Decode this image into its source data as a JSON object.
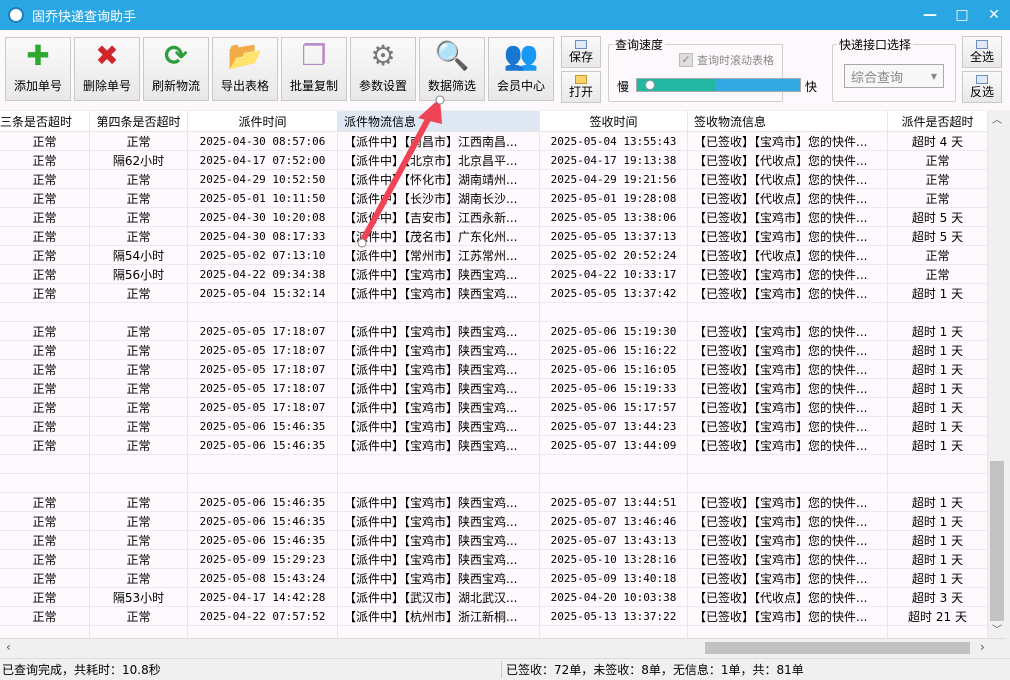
{
  "window": {
    "title": "固乔快递查询助手",
    "minimize": "—",
    "maximize": "□",
    "close": "✕",
    "accent": "#2aa7e3"
  },
  "toolbar": {
    "buttons": [
      {
        "label": "添加单号",
        "icon": "plus-icon"
      },
      {
        "label": "删除单号",
        "icon": "delete-x-icon"
      },
      {
        "label": "刷新物流",
        "icon": "refresh-icon"
      },
      {
        "label": "导出表格",
        "icon": "folder-export-icon"
      },
      {
        "label": "批量复制",
        "icon": "copy-icon"
      },
      {
        "label": "参数设置",
        "icon": "gear-icon"
      },
      {
        "label": "数据筛选",
        "icon": "search-filter-icon"
      },
      {
        "label": "会员中心",
        "icon": "members-icon"
      }
    ],
    "save": "保存",
    "open": "打开",
    "speed": {
      "title": "查询速度",
      "scroll_checkbox": "查询时滚动表格",
      "scroll_checked": true,
      "slow": "慢",
      "fast": "快",
      "level_percent": 48
    },
    "api": {
      "title": "快递接口选择",
      "selected": "综合查询"
    },
    "select_all": "全选",
    "invert": "反选"
  },
  "table": {
    "columns": [
      "三条是否超时",
      "第四条是否超时",
      "派件时间",
      "派件物流信息",
      "签收时间",
      "签收物流信息",
      "派件是否超时"
    ],
    "rows": [
      [
        "正常",
        "正常",
        "2025-04-30 08:57:06",
        "【派件中】【南昌市】江西南昌...",
        "2025-05-04 13:55:43",
        "【已签收】【宝鸡市】您的快件...",
        "超时 4 天"
      ],
      [
        "正常",
        "隔62小时",
        "2025-04-17 07:52:00",
        "【派件中】【北京市】北京昌平...",
        "2025-04-17 19:13:38",
        "【已签收】【代收点】您的快件...",
        "正常"
      ],
      [
        "正常",
        "正常",
        "2025-04-29 10:52:50",
        "【派件中】【怀化市】湖南靖州...",
        "2025-04-29 19:21:56",
        "【已签收】【代收点】您的快件...",
        "正常"
      ],
      [
        "正常",
        "正常",
        "2025-05-01 10:11:50",
        "【派件中】【长沙市】湖南长沙...",
        "2025-05-01 19:28:08",
        "【已签收】【代收点】您的快件...",
        "正常"
      ],
      [
        "正常",
        "正常",
        "2025-04-30 10:20:08",
        "【派件中】【吉安市】江西永新...",
        "2025-05-05 13:38:06",
        "【已签收】【宝鸡市】您的快件...",
        "超时 5 天"
      ],
      [
        "正常",
        "正常",
        "2025-04-30 08:17:33",
        "【派件中】【茂名市】广东化州...",
        "2025-05-05 13:37:13",
        "【已签收】【宝鸡市】您的快件...",
        "超时 5 天"
      ],
      [
        "正常",
        "隔54小时",
        "2025-05-02 07:13:10",
        "【派件中】【常州市】江苏常州...",
        "2025-05-02 20:52:24",
        "【已签收】【代收点】您的快件...",
        "正常"
      ],
      [
        "正常",
        "隔56小时",
        "2025-04-22 09:34:38",
        "【派件中】【宝鸡市】陕西宝鸡...",
        "2025-04-22 10:33:17",
        "【已签收】【宝鸡市】您的快件...",
        "正常"
      ],
      [
        "正常",
        "正常",
        "2025-05-04 15:32:14",
        "【派件中】【宝鸡市】陕西宝鸡...",
        "2025-05-05 13:37:42",
        "【已签收】【宝鸡市】您的快件...",
        "超时 1 天"
      ],
      null,
      [
        "正常",
        "正常",
        "2025-05-05 17:18:07",
        "【派件中】【宝鸡市】陕西宝鸡...",
        "2025-05-06 15:19:30",
        "【已签收】【宝鸡市】您的快件...",
        "超时 1 天"
      ],
      [
        "正常",
        "正常",
        "2025-05-05 17:18:07",
        "【派件中】【宝鸡市】陕西宝鸡...",
        "2025-05-06 15:16:22",
        "【已签收】【宝鸡市】您的快件...",
        "超时 1 天"
      ],
      [
        "正常",
        "正常",
        "2025-05-05 17:18:07",
        "【派件中】【宝鸡市】陕西宝鸡...",
        "2025-05-06 15:16:05",
        "【已签收】【宝鸡市】您的快件...",
        "超时 1 天"
      ],
      [
        "正常",
        "正常",
        "2025-05-05 17:18:07",
        "【派件中】【宝鸡市】陕西宝鸡...",
        "2025-05-06 15:19:33",
        "【已签收】【宝鸡市】您的快件...",
        "超时 1 天"
      ],
      [
        "正常",
        "正常",
        "2025-05-05 17:18:07",
        "【派件中】【宝鸡市】陕西宝鸡...",
        "2025-05-06 15:17:57",
        "【已签收】【宝鸡市】您的快件...",
        "超时 1 天"
      ],
      [
        "正常",
        "正常",
        "2025-05-06 15:46:35",
        "【派件中】【宝鸡市】陕西宝鸡...",
        "2025-05-07 13:44:23",
        "【已签收】【宝鸡市】您的快件...",
        "超时 1 天"
      ],
      [
        "正常",
        "正常",
        "2025-05-06 15:46:35",
        "【派件中】【宝鸡市】陕西宝鸡...",
        "2025-05-07 13:44:09",
        "【已签收】【宝鸡市】您的快件...",
        "超时 1 天"
      ],
      null,
      null,
      [
        "正常",
        "正常",
        "2025-05-06 15:46:35",
        "【派件中】【宝鸡市】陕西宝鸡...",
        "2025-05-07 13:44:51",
        "【已签收】【宝鸡市】您的快件...",
        "超时 1 天"
      ],
      [
        "正常",
        "正常",
        "2025-05-06 15:46:35",
        "【派件中】【宝鸡市】陕西宝鸡...",
        "2025-05-07 13:46:46",
        "【已签收】【宝鸡市】您的快件...",
        "超时 1 天"
      ],
      [
        "正常",
        "正常",
        "2025-05-06 15:46:35",
        "【派件中】【宝鸡市】陕西宝鸡...",
        "2025-05-07 13:43:13",
        "【已签收】【宝鸡市】您的快件...",
        "超时 1 天"
      ],
      [
        "正常",
        "正常",
        "2025-05-09 15:29:23",
        "【派件中】【宝鸡市】陕西宝鸡...",
        "2025-05-10 13:28:16",
        "【已签收】【宝鸡市】您的快件...",
        "超时 1 天"
      ],
      [
        "正常",
        "正常",
        "2025-05-08 15:43:24",
        "【派件中】【宝鸡市】陕西宝鸡...",
        "2025-05-09 13:40:18",
        "【已签收】【宝鸡市】您的快件...",
        "超时 1 天"
      ],
      [
        "正常",
        "隔53小时",
        "2025-04-17 14:42:28",
        "【派件中】【武汉市】湖北武汉...",
        "2025-04-20 10:03:38",
        "【已签收】【代收点】您的快件...",
        "超时 3 天"
      ],
      [
        "正常",
        "正常",
        "2025-04-22 07:57:52",
        "【派件中】【杭州市】浙江新桐...",
        "2025-05-13 13:37:22",
        "【已签收】【宝鸡市】您的快件...",
        "超时 21 天"
      ],
      null
    ]
  },
  "status": {
    "left": "已查询完成，共耗时：10.8秒",
    "right": "已签收：72单，未签收：8单，无信息：1单，共：81单"
  },
  "annotation": {
    "type": "red-arrow",
    "color": "#ee4455",
    "points_to": "数据筛选"
  }
}
